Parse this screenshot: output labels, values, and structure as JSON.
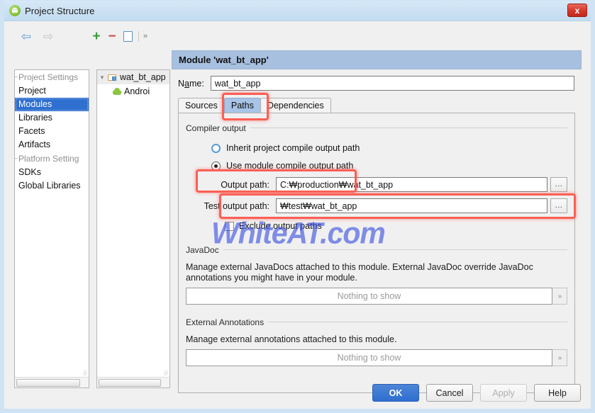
{
  "window": {
    "title": "Project Structure",
    "app_icon": "android-studio-icon",
    "close_label": "x"
  },
  "toolbar": {
    "back_icon": "arrow-left-icon",
    "forward_icon": "arrow-right-icon",
    "add_icon": "plus-icon",
    "remove_icon": "minus-icon",
    "copy_icon": "copy-icon",
    "overflow_icon": "chevron-double-right-icon",
    "add_label": "+",
    "remove_label": "−",
    "overflow_label": "»"
  },
  "sidebar": {
    "groups": [
      {
        "header": "Project Settings",
        "items": [
          {
            "label": "Project",
            "selected": false
          },
          {
            "label": "Modules",
            "selected": true
          },
          {
            "label": "Libraries",
            "selected": false
          },
          {
            "label": "Facets",
            "selected": false
          },
          {
            "label": "Artifacts",
            "selected": false
          }
        ]
      },
      {
        "header": "Platform Setting",
        "items": [
          {
            "label": "SDKs",
            "selected": false
          },
          {
            "label": "Global Libraries",
            "selected": false
          }
        ]
      }
    ]
  },
  "tree": {
    "root": {
      "label": "wat_bt_app",
      "icon": "module-folder-icon",
      "expander": "▼"
    },
    "child": {
      "label": "Androi",
      "icon": "android-robot-icon"
    }
  },
  "module": {
    "header": "Module 'wat_bt_app'",
    "name_label_pre": "N",
    "name_label_mnemonic": "a",
    "name_label_post": "me:",
    "name_value": "wat_bt_app",
    "tabs": [
      {
        "label": "Sources",
        "selected": false
      },
      {
        "label": "Paths",
        "selected": true
      },
      {
        "label": "Dependencies",
        "selected": false
      }
    ]
  },
  "compiler_output": {
    "group_title": "Compiler output",
    "inherit_radio_label": "Inherit project compile output path",
    "inherit_radio_checked": false,
    "module_radio_label": "Use module compile output path",
    "module_radio_checked": true,
    "output_path_label": "Output path:",
    "output_path_value": "C:₩production₩wat_bt_app",
    "test_output_path_label": "Test output path:",
    "test_output_path_value": "₩test₩wat_bt_app",
    "browse_label": "...",
    "exclude_label": "Exclude output paths",
    "exclude_checked": false
  },
  "javadoc": {
    "group_title": "JavaDoc",
    "description": "Manage external JavaDocs attached to this module. External JavaDoc override JavaDoc annotations you might have in your module.",
    "empty_text": "Nothing to show",
    "expand_label": "»"
  },
  "external_annotations": {
    "group_title": "External Annotations",
    "description": "Manage external annotations attached to this module.",
    "empty_text": "Nothing to show",
    "expand_label": "»"
  },
  "buttons": {
    "ok": "OK",
    "cancel": "Cancel",
    "apply": "Apply",
    "help": "Help"
  },
  "watermark": {
    "text": "WhiteAT.com"
  },
  "colors": {
    "accent": "#2f6fd0",
    "annotation": "#fb5f55",
    "tab_selected": "#a8c4e6",
    "header": "#a8c0e0",
    "watermark": "#3b4fe0"
  }
}
